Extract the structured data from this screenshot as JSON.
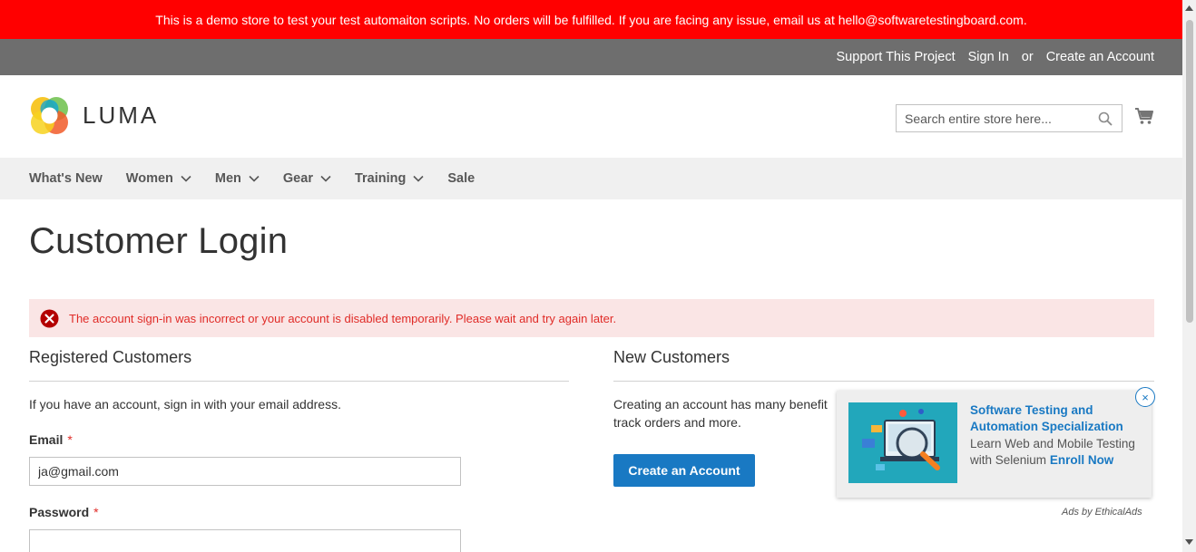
{
  "demo_banner": "This is a demo store to test your test automaiton scripts. No orders will be fulfilled. If you are facing any issue, email us at hello@softwaretestingboard.com.",
  "header_links": {
    "support": "Support This Project",
    "sign_in": "Sign In",
    "or": "or",
    "create_account": "Create an Account"
  },
  "logo_text": "LUMA",
  "search": {
    "placeholder": "Search entire store here..."
  },
  "nav": [
    {
      "label": "What's New",
      "has_dropdown": false
    },
    {
      "label": "Women",
      "has_dropdown": true
    },
    {
      "label": "Men",
      "has_dropdown": true
    },
    {
      "label": "Gear",
      "has_dropdown": true
    },
    {
      "label": "Training",
      "has_dropdown": true
    },
    {
      "label": "Sale",
      "has_dropdown": false
    }
  ],
  "page_title": "Customer Login",
  "error_message": "The account sign-in was incorrect or your account is disabled temporarily. Please wait and try again later.",
  "registered": {
    "title": "Registered Customers",
    "intro": "If you have an account, sign in with your email address.",
    "email_label": "Email",
    "email_value": "ja@gmail.com",
    "password_label": "Password",
    "password_value": "",
    "required_mark": "*"
  },
  "new_customers": {
    "title": "New Customers",
    "intro_line1": "Creating an account has many benefit",
    "intro_line2": "track orders and more.",
    "button": "Create an Account"
  },
  "ad": {
    "headline": "Software Testing and Automation Specialization",
    "body": "Learn Web and Mobile Testing with Selenium",
    "cta": "Enroll Now",
    "close": "×",
    "attribution": "Ads by EthicalAds"
  },
  "colors": {
    "banner": "#ff0000",
    "panel": "#6e6e6e",
    "accent": "#1979c3",
    "error_bg": "#fae5e5",
    "error_text": "#e02b27"
  }
}
